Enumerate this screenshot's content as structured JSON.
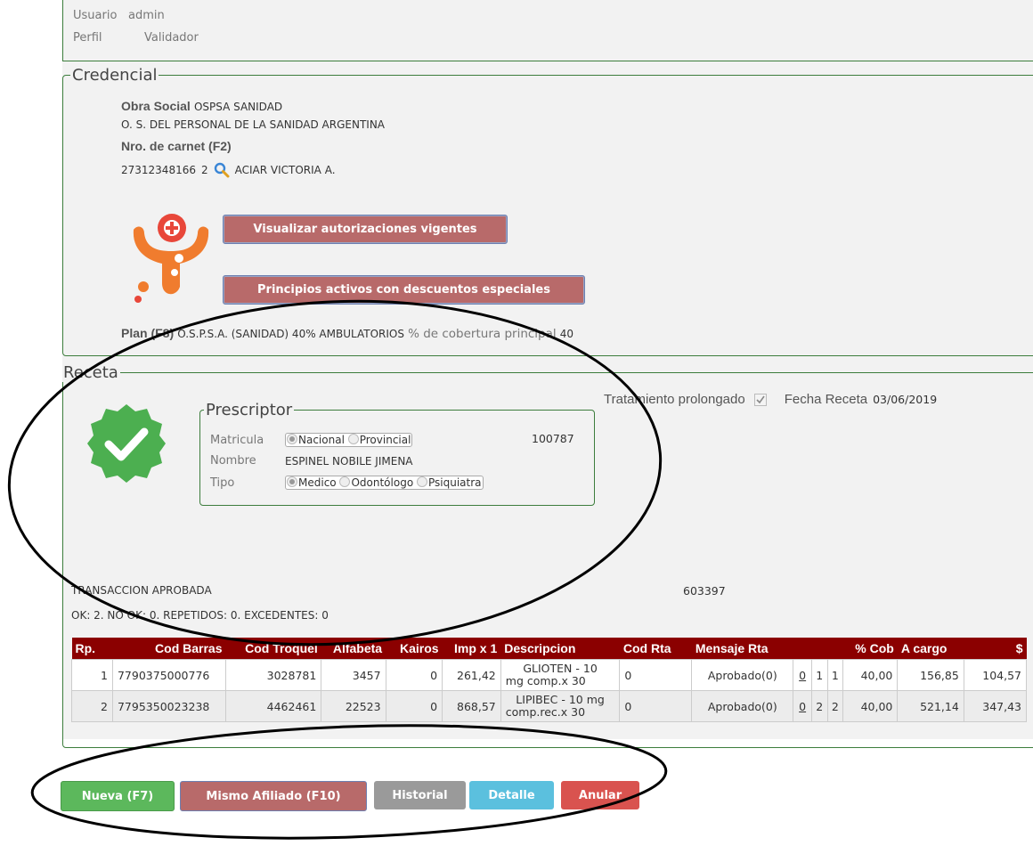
{
  "user": {
    "usuario_label": "Usuario",
    "usuario_value": "admin",
    "perfil_label": "Perfil",
    "perfil_value": "Validador"
  },
  "credencial": {
    "legend": "Credencial",
    "obra_social_label": "Obra Social",
    "obra_social_code": "OSPSA SANIDAD",
    "obra_social_name": "O. S. DEL PERSONAL DE LA SANIDAD ARGENTINA",
    "carnet_label": "Nro. de carnet (F2)",
    "carnet_number": "27312348166",
    "carnet_suffix": "2",
    "afiliado_name": "ACIAR VICTORIA A.",
    "btn_autorizaciones": "Visualizar autorizaciones vigentes",
    "btn_principios": "Principios activos con descuentos especiales",
    "plan_label": "Plan (F8)",
    "plan_value": "O.S.P.S.A. (SANIDAD) 40% AMBULATORIOS",
    "cobertura_label": "% de cobertura principal",
    "cobertura_value": "40"
  },
  "receta": {
    "legend": "Receta",
    "tratamiento_label": "Tratamiento prolongado",
    "tratamiento_checked": true,
    "fecha_label": "Fecha Receta",
    "fecha_value": "03/06/2019",
    "prescriptor": {
      "legend": "Prescriptor",
      "matricula_label": "Matricula",
      "matricula_options": [
        "Nacional",
        "Provincial"
      ],
      "matricula_selected": "Nacional",
      "matricula_value": "100787",
      "nombre_label": "Nombre",
      "nombre_value": "ESPINEL NOBILE JIMENA",
      "tipo_label": "Tipo",
      "tipo_options": [
        "Medico",
        "Odontólogo",
        "Psiquiatra"
      ],
      "tipo_selected": "Medico"
    },
    "transaccion_status": "TRANSACCION APROBADA",
    "transaccion_id": "603397",
    "summary": "OK: 2. NO OK: 0. REPETIDOS: 0. EXCEDENTES: 0"
  },
  "table": {
    "headers": [
      "Rp.",
      "Cod Barras",
      "Cod Troquel",
      "Alfabeta",
      "Kairos",
      "Imp x 1",
      "Descripcion",
      "Cod Rta",
      "Mensaje Rta",
      "",
      "",
      "",
      "% Cob",
      "A cargo",
      "$"
    ],
    "rows": [
      {
        "rp": "1",
        "barras": "7790375000776",
        "troquel": "3028781",
        "alfabeta": "3457",
        "kairos": "0",
        "imp": "261,42",
        "desc_line1": "GLIOTEN - 10",
        "desc_line2": "mg comp.x 30",
        "cod_rta": "0",
        "mensaje": "Aprobado(0)",
        "link": "0",
        "c1": "1",
        "c2": "1",
        "cob": "40,00",
        "cargo": "156,85",
        "pesos": "104,57"
      },
      {
        "rp": "2",
        "barras": "7795350023238",
        "troquel": "4462461",
        "alfabeta": "22523",
        "kairos": "0",
        "imp": "868,57",
        "desc_line1": "LIPIBEC - 10 mg",
        "desc_line2": "comp.rec.x 30",
        "cod_rta": "0",
        "mensaje": "Aprobado(0)",
        "link": "0",
        "c1": "2",
        "c2": "2",
        "cob": "40,00",
        "cargo": "521,14",
        "pesos": "347,43"
      }
    ]
  },
  "actions": {
    "nueva": "Nueva (F7)",
    "mismo": "Mismo Afiliado (F10)",
    "historial": "Historial",
    "detalle": "Detalle",
    "anular": "Anular"
  },
  "colors": {
    "green_border": "#3c7d3c",
    "table_header": "#8b0000",
    "btn_nueva": "#5cb85c",
    "btn_mismo": "#b86a6a",
    "btn_historial": "#9a9a9a",
    "btn_detalle": "#5bc0de",
    "btn_anular": "#d9534f"
  }
}
